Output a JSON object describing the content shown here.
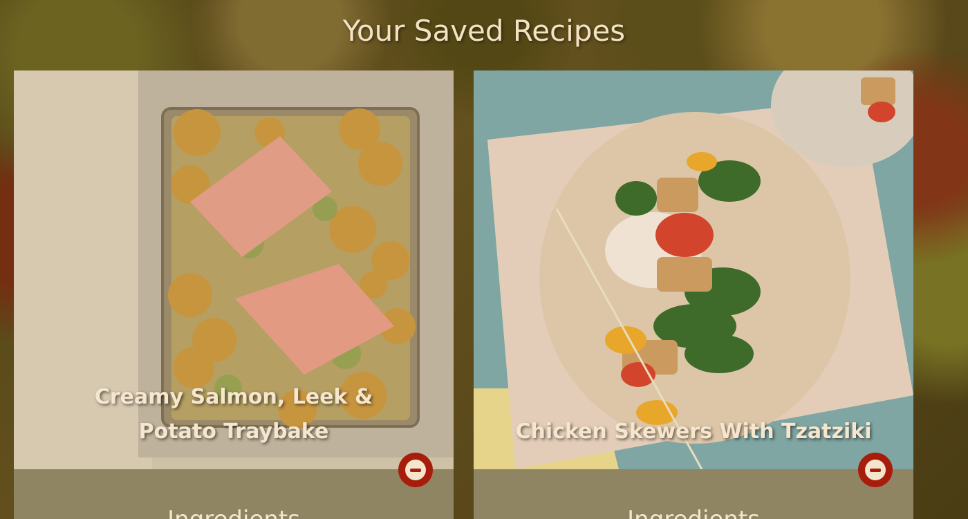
{
  "page": {
    "title": "Your Saved Recipes"
  },
  "recipes": [
    {
      "title": "Creamy Salmon, Leek & Potato Traybake",
      "remove_icon": "minus-circle-icon",
      "section_label": "Ingredients"
    },
    {
      "title": "Chicken Skewers With Tzatziki",
      "remove_icon": "minus-circle-icon",
      "section_label": "Ingredients"
    }
  ],
  "colors": {
    "title_text": "#f3e3c3",
    "card_footer": "#8f8562",
    "remove_button": "#a81c0b"
  }
}
